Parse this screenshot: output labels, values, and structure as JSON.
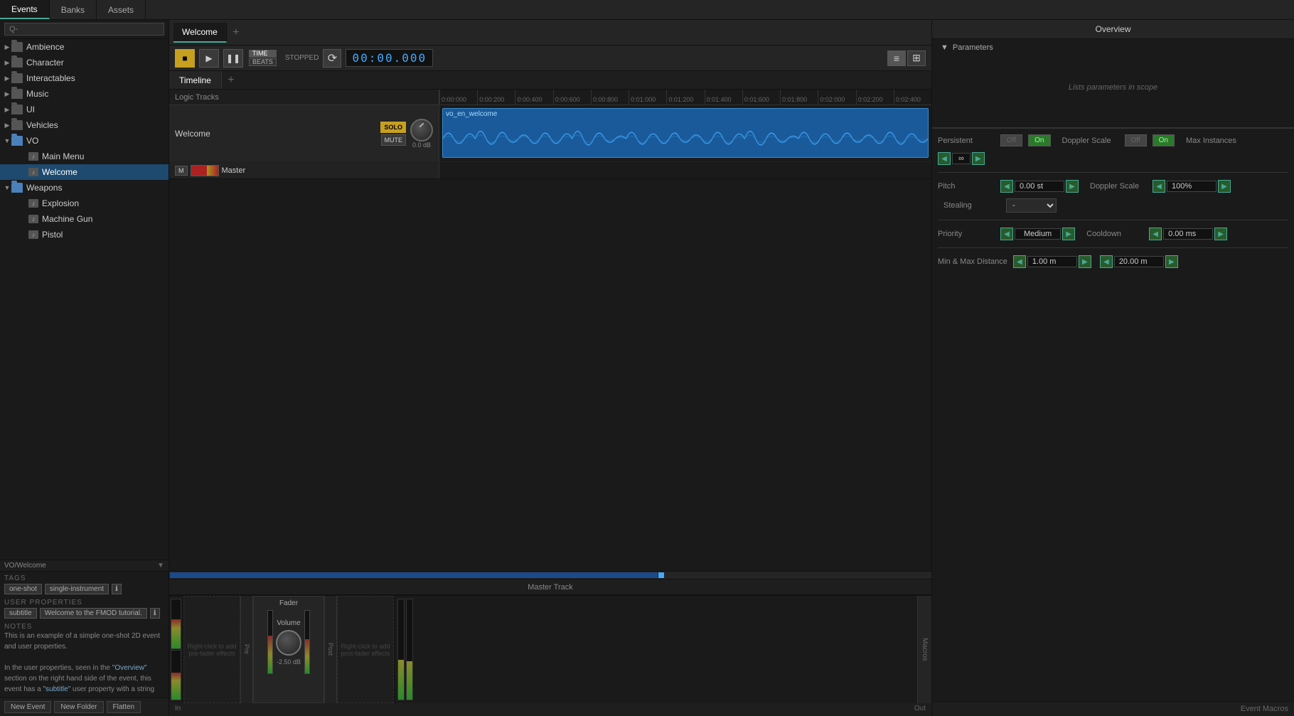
{
  "tabs": {
    "events_label": "Events",
    "banks_label": "Banks",
    "assets_label": "Assets"
  },
  "welcome_tab": {
    "label": "Welcome",
    "add_label": "+"
  },
  "transport": {
    "stop_label": "■",
    "play_label": "▶",
    "pause_label": "❚❚",
    "time_display": "00:00.000",
    "time_mode_time": "TIME",
    "time_mode_beats": "BEATS",
    "status": "STOPPED",
    "loop_label": "⟳",
    "view_list_label": "≡",
    "view_grid_label": "⊞"
  },
  "editor_tabs": {
    "timeline_label": "Timeline",
    "add_label": "+"
  },
  "timeline": {
    "logic_tracks_label": "Logic Tracks",
    "ruler_marks": [
      "0:00:00",
      "0:00:200",
      "0:00:400",
      "0:00:600",
      "0:00:800",
      "0:01:000",
      "0:01:200",
      "0:01:400",
      "0:01:600",
      "0:01:800",
      "0:02:000",
      "0:02:200",
      "0:02:400"
    ],
    "track_name": "Welcome",
    "track_solo": "SOLO",
    "track_mute": "MUTE",
    "track_volume_db": "0.0 dB",
    "clip_label": "vo_en_welcome",
    "master_label": "Master",
    "master_btn": "M"
  },
  "sidebar": {
    "search_placeholder": "Q-",
    "items": [
      {
        "label": "Ambience",
        "type": "folder",
        "indent": 0,
        "arrow": "▶"
      },
      {
        "label": "Character",
        "type": "folder",
        "indent": 0,
        "arrow": "▶"
      },
      {
        "label": "Interactables",
        "type": "folder",
        "indent": 0,
        "arrow": "▶"
      },
      {
        "label": "Music",
        "type": "folder",
        "indent": 0,
        "arrow": "▶"
      },
      {
        "label": "UI",
        "type": "folder",
        "indent": 0,
        "arrow": "▶"
      },
      {
        "label": "Vehicles",
        "type": "folder",
        "indent": 0,
        "arrow": "▶"
      },
      {
        "label": "VO",
        "type": "folder",
        "indent": 0,
        "arrow": "▼",
        "open": true
      },
      {
        "label": "Main Menu",
        "type": "event",
        "indent": 2,
        "arrow": ""
      },
      {
        "label": "Welcome",
        "type": "event",
        "indent": 2,
        "arrow": "",
        "selected": true
      },
      {
        "label": "Weapons",
        "type": "folder",
        "indent": 0,
        "arrow": "▼",
        "open": true
      },
      {
        "label": "Explosion",
        "type": "event",
        "indent": 2,
        "arrow": ""
      },
      {
        "label": "Machine Gun",
        "type": "event",
        "indent": 2,
        "arrow": ""
      },
      {
        "label": "Pistol",
        "type": "event",
        "indent": 2,
        "arrow": ""
      }
    ]
  },
  "overview": {
    "title": "Overview",
    "parameters_label": "Parameters",
    "parameters_empty": "Lists parameters in scope"
  },
  "event_properties": {
    "persistent_label": "Persistent",
    "doppler_label": "Doppler Scale",
    "max_instances_label": "Max Instances",
    "off_label": "Off",
    "on_label": "On",
    "pitch_label": "Pitch",
    "pitch_value": "0.00 st",
    "doppler_value": "100%",
    "cooldown_label": "Cooldown",
    "stealing_label": "Stealing",
    "priority_label": "Priority",
    "priority_value": "Medium",
    "cooldown_value": "0.00 ms",
    "min_max_distance_label": "Min & Max Distance",
    "event_macros_label": "Event Macros"
  },
  "bottom_panel": {
    "breadcrumb": "VO/Welcome",
    "tags_label": "Tags",
    "tag_one_shot": "one-shot",
    "tag_single_instrument": "single-instrument",
    "user_props_label": "User Properties",
    "subtitle_key": "subtitle",
    "subtitle_value": "Welcome to the FMOD tutorial.",
    "notes_label": "Notes",
    "notes_text": "This is an example of a simple one-shot 2D event and user properties.\n\nIn the user properties, seen in the \"Overview\" section on the right hand side of the event, this event has a \"subtitle\" user property with a string",
    "new_event_btn": "New Event",
    "new_folder_btn": "New Folder",
    "flatten_btn": "Flatten"
  },
  "mixer": {
    "fader_label": "Fader",
    "volume_label": "Volume",
    "volume_db": "-2.50 dB",
    "pre_label": "Pre",
    "post_label": "Post",
    "in_label": "In",
    "out_label": "Out",
    "master_track_label": "Master Track",
    "right_click_pre": "Right-click to add pre-fader effects",
    "right_click_post": "Right-click to add post-fader effects"
  },
  "colors": {
    "accent_blue": "#1a5a9a",
    "accent_yellow": "#c8a020",
    "accent_green": "#2a8a2a",
    "clip_blue": "#1a5a9a"
  }
}
